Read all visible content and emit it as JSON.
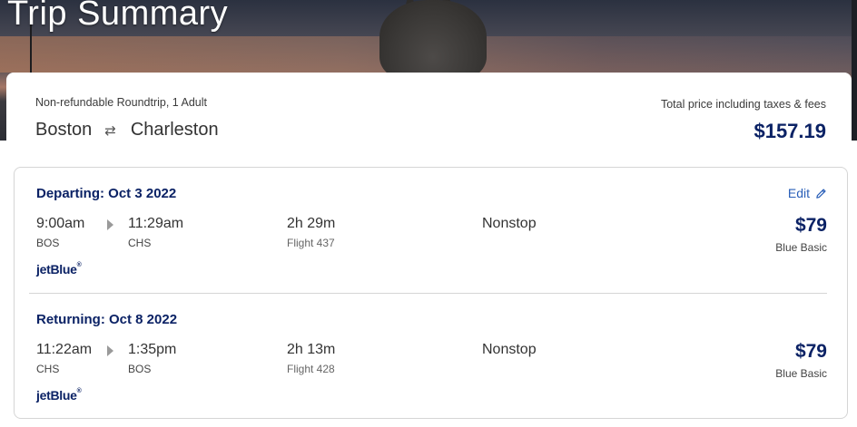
{
  "header": {
    "title": "Trip Summary"
  },
  "summary": {
    "trip_type": "Non-refundable Roundtrip, 1 Adult",
    "origin": "Boston",
    "swap_icon": "⇄",
    "destination": "Charleston",
    "total_label": "Total price including taxes & fees",
    "total_price": "$157.19"
  },
  "departing": {
    "title": "Departing: Oct 3 2022",
    "edit_label": "Edit",
    "depart_time": "9:00am",
    "arrive_time": "11:29am",
    "depart_code": "BOS",
    "arrive_code": "CHS",
    "duration": "2h 29m",
    "flight_number": "Flight 437",
    "stops": "Nonstop",
    "price": "$79",
    "fare_class": "Blue Basic",
    "airline": "jetBlue"
  },
  "returning": {
    "title": "Returning: Oct 8 2022",
    "depart_time": "11:22am",
    "arrive_time": "1:35pm",
    "depart_code": "CHS",
    "arrive_code": "BOS",
    "duration": "2h 13m",
    "flight_number": "Flight 428",
    "stops": "Nonstop",
    "price": "$79",
    "fare_class": "Blue Basic",
    "airline": "jetBlue"
  },
  "colors": {
    "brand_navy": "#0b2265",
    "link_blue": "#2a5fb8"
  }
}
